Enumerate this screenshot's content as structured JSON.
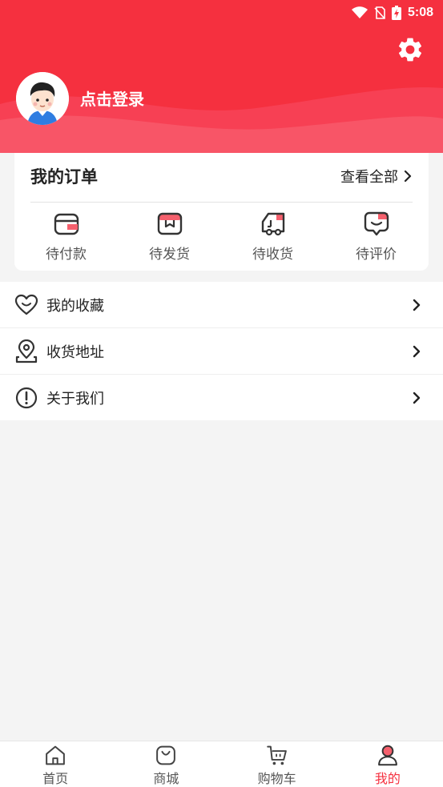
{
  "status_bar": {
    "time": "5:08"
  },
  "header": {
    "login_text": "点击登录",
    "accent": "#f5303f"
  },
  "orders": {
    "title": "我的订单",
    "view_all": "查看全部",
    "statuses": [
      {
        "label": "待付款",
        "icon": "wallet-icon"
      },
      {
        "label": "待发货",
        "icon": "package-icon"
      },
      {
        "label": "待收货",
        "icon": "truck-icon"
      },
      {
        "label": "待评价",
        "icon": "review-icon"
      }
    ]
  },
  "menu": [
    {
      "label": "我的收藏",
      "icon": "heart-icon"
    },
    {
      "label": "收货地址",
      "icon": "location-pin-icon"
    },
    {
      "label": "关于我们",
      "icon": "info-icon"
    }
  ],
  "tabs": [
    {
      "label": "首页",
      "icon": "home-icon"
    },
    {
      "label": "商城",
      "icon": "shopping-bag-icon"
    },
    {
      "label": "购物车",
      "icon": "cart-icon"
    },
    {
      "label": "我的",
      "icon": "user-icon",
      "active": true
    }
  ]
}
